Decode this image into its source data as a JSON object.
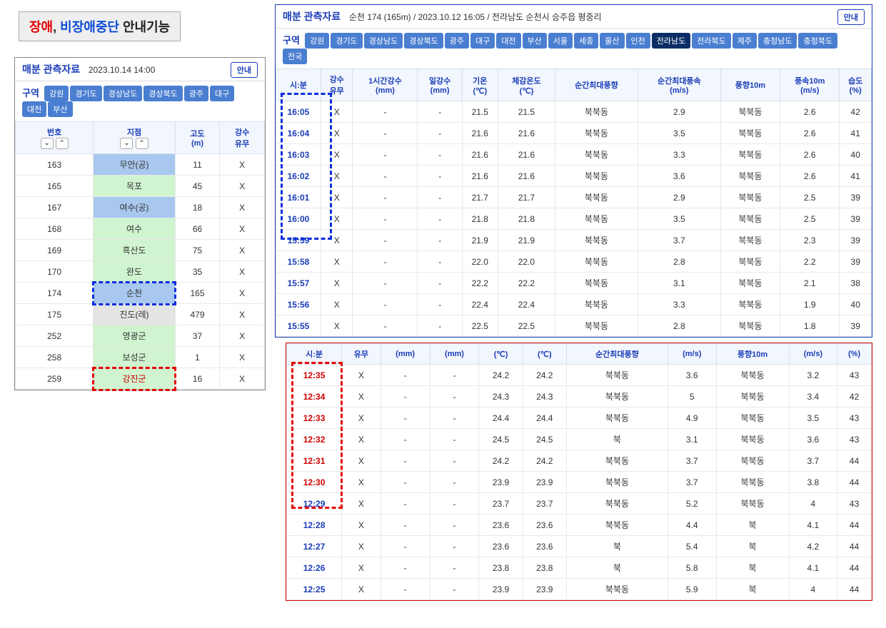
{
  "header_label": {
    "disabled": "장애",
    "nondisabled_pause": "비장애중단",
    "guide": "안내기능"
  },
  "left": {
    "title": "매분 관측자료",
    "datetime": "2023.10.14 14:00",
    "guide": "안내",
    "region_label": "구역",
    "regions": [
      "강원",
      "경기도",
      "경상남도",
      "경상북도",
      "광주",
      "대구",
      "대전",
      "부산"
    ],
    "cols": {
      "no": "번호",
      "loc": "지점",
      "alt": "고도\n(m)",
      "rain": "강수\n유무"
    },
    "rows": [
      {
        "no": "163",
        "loc": "무안(공)",
        "alt": "11",
        "rain": "X",
        "cls": "blue"
      },
      {
        "no": "165",
        "loc": "목포",
        "alt": "45",
        "rain": "X",
        "cls": "green"
      },
      {
        "no": "167",
        "loc": "여수(공)",
        "alt": "18",
        "rain": "X",
        "cls": "blue"
      },
      {
        "no": "168",
        "loc": "여수",
        "alt": "66",
        "rain": "X",
        "cls": "green"
      },
      {
        "no": "169",
        "loc": "흑산도",
        "alt": "75",
        "rain": "X",
        "cls": "green"
      },
      {
        "no": "170",
        "loc": "완도",
        "alt": "35",
        "rain": "X",
        "cls": "green"
      },
      {
        "no": "174",
        "loc": "순천",
        "alt": "165",
        "rain": "X",
        "cls": "green selblue"
      },
      {
        "no": "175",
        "loc": "진도(레)",
        "alt": "479",
        "rain": "X",
        "cls": "grey"
      },
      {
        "no": "252",
        "loc": "영광군",
        "alt": "37",
        "rain": "X",
        "cls": "green"
      },
      {
        "no": "258",
        "loc": "보성군",
        "alt": "1",
        "rain": "X",
        "cls": "green"
      },
      {
        "no": "259",
        "loc": "강진군",
        "alt": "16",
        "rain": "X",
        "cls": "green selred redtxt"
      }
    ]
  },
  "right": {
    "title": "매분 관측자료",
    "station": "순천 174 (165m) / 2023.10.12 16:05 / 전라남도 순천시 승주읍 평중리",
    "guide": "안내",
    "region_label": "구역",
    "regions": [
      "강원",
      "경기도",
      "경상남도",
      "경상북도",
      "광주",
      "대구",
      "대전",
      "부산",
      "서울",
      "세종",
      "울산",
      "인천",
      "전라남도",
      "전라북도",
      "제주",
      "충청남도",
      "충청북도",
      "전국"
    ],
    "active_region": "전라남도",
    "cols": [
      "시:분",
      "강수\n유무",
      "1시간강수\n(mm)",
      "일강수\n(mm)",
      "기온\n(℃)",
      "체감온도\n(℃)",
      "순간최대풍향",
      "순간최대풍속\n(m/s)",
      "풍향10m",
      "풍속10m\n(m/s)",
      "습도\n(%)"
    ],
    "rows": [
      {
        "t": "16:05",
        "r": "X",
        "h1": "-",
        "d": "-",
        "tp": "21.5",
        "ft": "21.5",
        "gd": "북북동",
        "gs": "2.9",
        "wd": "북북동",
        "ws": "2.6",
        "hm": "42",
        "hl": 1
      },
      {
        "t": "16:04",
        "r": "X",
        "h1": "-",
        "d": "-",
        "tp": "21.6",
        "ft": "21.6",
        "gd": "북북동",
        "gs": "3.5",
        "wd": "북북동",
        "ws": "2.6",
        "hm": "41",
        "hl": 1
      },
      {
        "t": "16:03",
        "r": "X",
        "h1": "-",
        "d": "-",
        "tp": "21.6",
        "ft": "21.6",
        "gd": "북북동",
        "gs": "3.3",
        "wd": "북북동",
        "ws": "2.6",
        "hm": "40",
        "hl": 1
      },
      {
        "t": "16:02",
        "r": "X",
        "h1": "-",
        "d": "-",
        "tp": "21.6",
        "ft": "21.6",
        "gd": "북북동",
        "gs": "3.6",
        "wd": "북북동",
        "ws": "2.6",
        "hm": "41",
        "hl": 1
      },
      {
        "t": "16:01",
        "r": "X",
        "h1": "-",
        "d": "-",
        "tp": "21.7",
        "ft": "21.7",
        "gd": "북북동",
        "gs": "2.9",
        "wd": "북북동",
        "ws": "2.5",
        "hm": "39",
        "hl": 1
      },
      {
        "t": "16:00",
        "r": "X",
        "h1": "-",
        "d": "-",
        "tp": "21.8",
        "ft": "21.8",
        "gd": "북북동",
        "gs": "3.5",
        "wd": "북북동",
        "ws": "2.5",
        "hm": "39",
        "hl": 1
      },
      {
        "t": "15:59",
        "r": "X",
        "h1": "-",
        "d": "-",
        "tp": "21.9",
        "ft": "21.9",
        "gd": "북북동",
        "gs": "3.7",
        "wd": "북북동",
        "ws": "2.3",
        "hm": "39"
      },
      {
        "t": "15:58",
        "r": "X",
        "h1": "-",
        "d": "-",
        "tp": "22.0",
        "ft": "22.0",
        "gd": "북북동",
        "gs": "2.8",
        "wd": "북북동",
        "ws": "2.2",
        "hm": "39"
      },
      {
        "t": "15:57",
        "r": "X",
        "h1": "-",
        "d": "-",
        "tp": "22.2",
        "ft": "22.2",
        "gd": "북북동",
        "gs": "3.1",
        "wd": "북북동",
        "ws": "2.1",
        "hm": "38"
      },
      {
        "t": "15:56",
        "r": "X",
        "h1": "-",
        "d": "-",
        "tp": "22.4",
        "ft": "22.4",
        "gd": "북북동",
        "gs": "3.3",
        "wd": "북북동",
        "ws": "1.9",
        "hm": "40"
      },
      {
        "t": "15:55",
        "r": "X",
        "h1": "-",
        "d": "-",
        "tp": "22.5",
        "ft": "22.5",
        "gd": "북북동",
        "gs": "2.8",
        "wd": "북북동",
        "ws": "1.8",
        "hm": "39"
      }
    ]
  },
  "bottom": {
    "cols_partial": [
      "시:분",
      "유무",
      "(mm)",
      "(mm)",
      "(℃)",
      "(℃)",
      "순간최대풍향",
      "(m/s)",
      "풍향10m",
      "(m/s)",
      "(%)"
    ],
    "rows": [
      {
        "t": "12:35",
        "r": "X",
        "h1": "-",
        "d": "-",
        "tp": "24.2",
        "ft": "24.2",
        "gd": "북북동",
        "gs": "3.6",
        "wd": "북북동",
        "ws": "3.2",
        "hm": "43",
        "hl": 1
      },
      {
        "t": "12:34",
        "r": "X",
        "h1": "-",
        "d": "-",
        "tp": "24.3",
        "ft": "24.3",
        "gd": "북북동",
        "gs": "5",
        "wd": "북북동",
        "ws": "3.4",
        "hm": "42",
        "hl": 1
      },
      {
        "t": "12:33",
        "r": "X",
        "h1": "-",
        "d": "-",
        "tp": "24.4",
        "ft": "24.4",
        "gd": "북북동",
        "gs": "4.9",
        "wd": "북북동",
        "ws": "3.5",
        "hm": "43",
        "hl": 1
      },
      {
        "t": "12:32",
        "r": "X",
        "h1": "-",
        "d": "-",
        "tp": "24.5",
        "ft": "24.5",
        "gd": "북",
        "gs": "3.1",
        "wd": "북북동",
        "ws": "3.6",
        "hm": "43",
        "hl": 1
      },
      {
        "t": "12:31",
        "r": "X",
        "h1": "-",
        "d": "-",
        "tp": "24.2",
        "ft": "24.2",
        "gd": "북북동",
        "gs": "3.7",
        "wd": "북북동",
        "ws": "3.7",
        "hm": "44",
        "hl": 1
      },
      {
        "t": "12:30",
        "r": "X",
        "h1": "-",
        "d": "-",
        "tp": "23.9",
        "ft": "23.9",
        "gd": "북북동",
        "gs": "3.7",
        "wd": "북북동",
        "ws": "3.8",
        "hm": "44",
        "hl": 1
      },
      {
        "t": "12:29",
        "r": "X",
        "h1": "-",
        "d": "-",
        "tp": "23.7",
        "ft": "23.7",
        "gd": "북북동",
        "gs": "5.2",
        "wd": "북북동",
        "ws": "4",
        "hm": "43"
      },
      {
        "t": "12:28",
        "r": "X",
        "h1": "-",
        "d": "-",
        "tp": "23.6",
        "ft": "23.6",
        "gd": "북북동",
        "gs": "4.4",
        "wd": "북",
        "ws": "4.1",
        "hm": "44"
      },
      {
        "t": "12:27",
        "r": "X",
        "h1": "-",
        "d": "-",
        "tp": "23.6",
        "ft": "23.6",
        "gd": "북",
        "gs": "5.4",
        "wd": "북",
        "ws": "4.2",
        "hm": "44"
      },
      {
        "t": "12:26",
        "r": "X",
        "h1": "-",
        "d": "-",
        "tp": "23.8",
        "ft": "23.8",
        "gd": "북",
        "gs": "5.8",
        "wd": "북",
        "ws": "4.1",
        "hm": "44"
      },
      {
        "t": "12:25",
        "r": "X",
        "h1": "-",
        "d": "-",
        "tp": "23.9",
        "ft": "23.9",
        "gd": "북북동",
        "gs": "5.9",
        "wd": "북",
        "ws": "4",
        "hm": "44"
      }
    ]
  }
}
